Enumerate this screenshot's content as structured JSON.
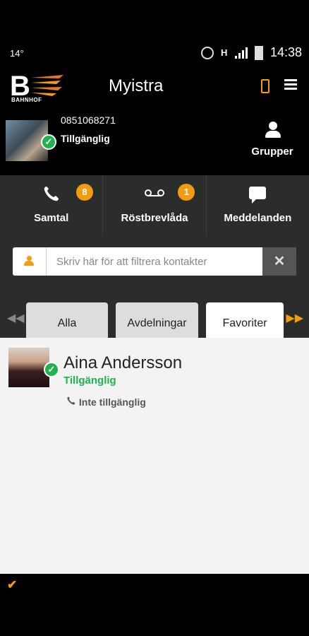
{
  "status_bar": {
    "temp": "14°",
    "network": "H",
    "time": "14:38"
  },
  "header": {
    "logo_text": "B",
    "logo_word": "BAHNHOF",
    "title": "Myistra",
    "icons": [
      "phone-icon",
      "menu-icon"
    ]
  },
  "profile": {
    "number": "0851068271",
    "status": "Tillgänglig",
    "groups_label": "Grupper"
  },
  "nav": [
    {
      "label": "Samtal",
      "badge": "8",
      "icon": "phone-handset-icon"
    },
    {
      "label": "Röstbrevlåda",
      "badge": "1",
      "icon": "voicemail-icon"
    },
    {
      "label": "Meddelanden",
      "badge": "",
      "icon": "message-icon"
    }
  ],
  "filter": {
    "placeholder": "Skriv här för att filtrera kontakter",
    "clear_glyph": "✕"
  },
  "tabs": {
    "items": [
      "Alla",
      "Avdelningar",
      "Favoriter"
    ],
    "active": "Favoriter"
  },
  "contacts": [
    {
      "name": "Aina Andersson",
      "status": "Tillgänglig",
      "phone_status": "Inte tillgänglig"
    }
  ],
  "colors": {
    "accent": "#f39c12",
    "available": "#1fb34d",
    "panel": "#2b2d2d"
  }
}
